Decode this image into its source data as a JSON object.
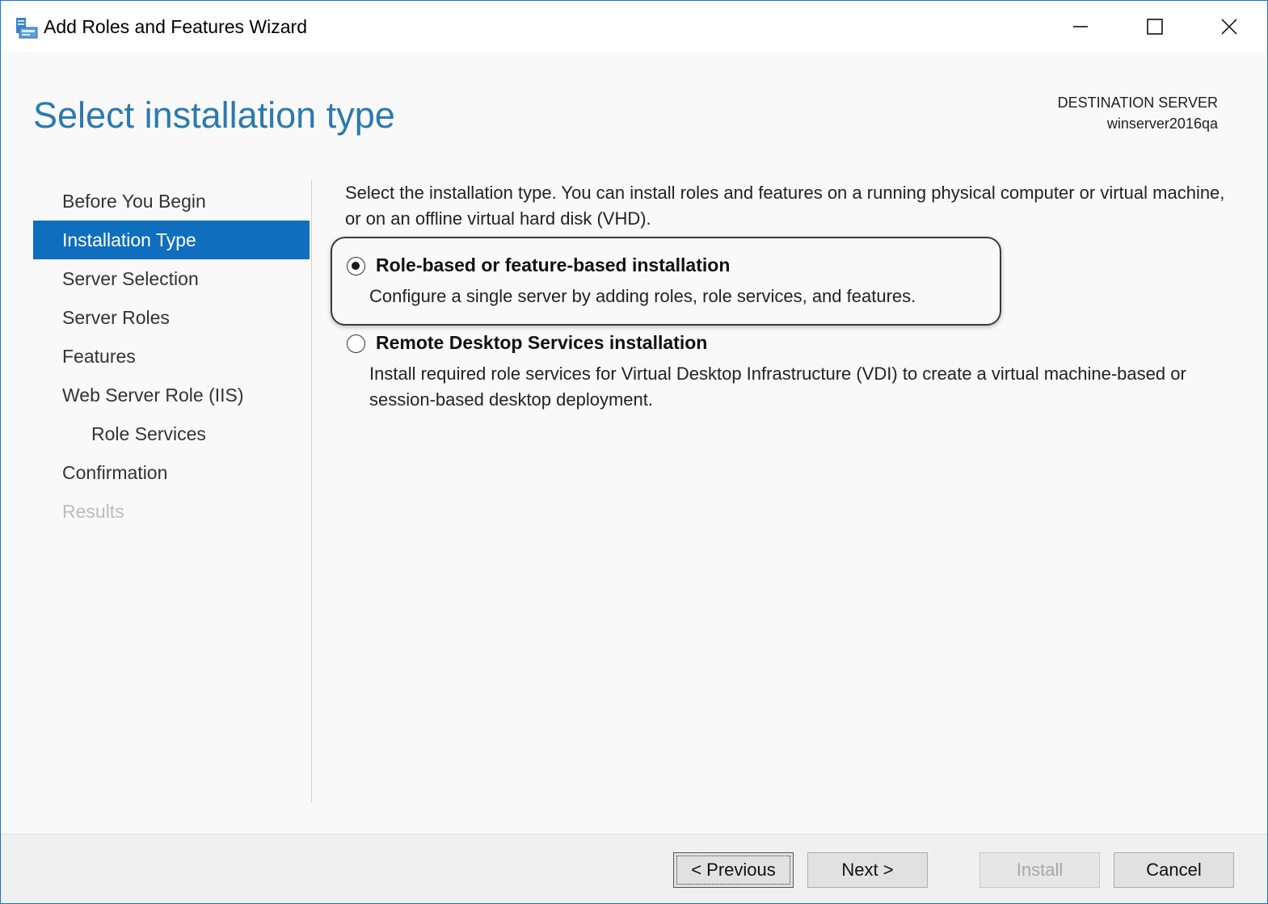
{
  "window": {
    "title": "Add Roles and Features Wizard",
    "controls": {
      "minimize": "minimize",
      "maximize": "maximize",
      "close": "close"
    }
  },
  "header": {
    "page_title": "Select installation type",
    "destination_label": "DESTINATION SERVER",
    "destination_value": "winserver2016qa"
  },
  "nav": {
    "items": [
      {
        "label": "Before You Begin",
        "state": "normal"
      },
      {
        "label": "Installation Type",
        "state": "active"
      },
      {
        "label": "Server Selection",
        "state": "normal"
      },
      {
        "label": "Server Roles",
        "state": "normal"
      },
      {
        "label": "Features",
        "state": "normal"
      },
      {
        "label": "Web Server Role (IIS)",
        "state": "normal"
      },
      {
        "label": "Role Services",
        "state": "sub"
      },
      {
        "label": "Confirmation",
        "state": "normal"
      },
      {
        "label": "Results",
        "state": "disabled"
      }
    ]
  },
  "content": {
    "intro": "Select the installation type. You can install roles and features on a running physical computer or virtual machine, or on an offline virtual hard disk (VHD).",
    "options": [
      {
        "title": "Role-based or feature-based installation",
        "description": "Configure a single server by adding roles, role services, and features.",
        "selected": true
      },
      {
        "title": "Remote Desktop Services installation",
        "description": "Install required role services for Virtual Desktop Infrastructure (VDI) to create a virtual machine-based or session-based desktop deployment.",
        "selected": false
      }
    ]
  },
  "footer": {
    "previous_label": "< Previous",
    "next_label": "Next >",
    "install_label": "Install",
    "cancel_label": "Cancel"
  },
  "colors": {
    "accent": "#0f6ebd",
    "title_blue": "#2a7ab0",
    "disabled_text": "#bcbcbc"
  }
}
